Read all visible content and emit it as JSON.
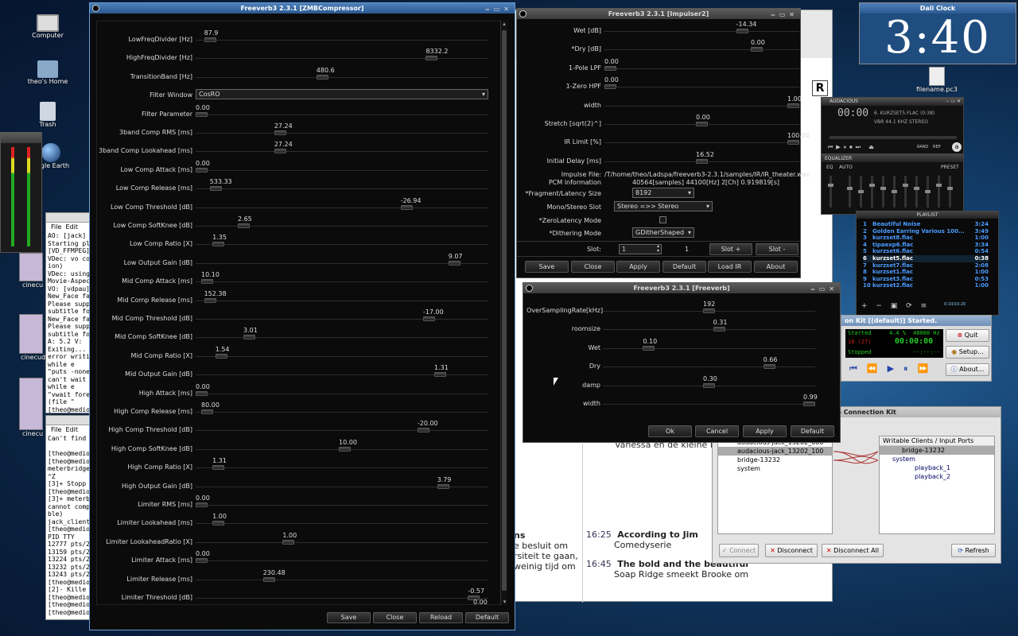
{
  "desktop": {
    "icons": [
      "Computer",
      "theo's Home",
      "Trash",
      "gle Earth",
      "cinecu",
      "cinecuda",
      "cinecu",
      "filename.pc3"
    ]
  },
  "clock": {
    "title": "Dali Clock",
    "time": "3:40"
  },
  "zmb": {
    "title": "Freeverb3 2.3.1 [ZMBCompressor]",
    "params": [
      {
        "label": "LowFreqDivider [Hz]",
        "value": "87.9",
        "pos": 0.03
      },
      {
        "label": "HighFreqDivider [Hz]",
        "value": "8332.2",
        "pos": 0.82
      },
      {
        "label": "TransitionBand [Hz]",
        "value": "480.6",
        "pos": 0.43
      },
      {
        "label": "Filter Window",
        "select": "CosRO"
      },
      {
        "label": "Filter Parameter",
        "value": "0.00",
        "pos": 0.0
      },
      {
        "label": "3band Comp RMS [ms]",
        "value": "27.24",
        "pos": 0.28
      },
      {
        "label": "3band Comp Lookahead [ms]",
        "value": "27.24",
        "pos": 0.28
      },
      {
        "label": "Low Comp Attack [ms]",
        "value": "0.00",
        "pos": 0.0
      },
      {
        "label": "Low Comp Release [ms]",
        "value": "533.33",
        "pos": 0.05
      },
      {
        "label": "Low Comp Threshold [dB]",
        "value": "-26.94",
        "pos": 0.73
      },
      {
        "label": "Low Comp SoftKnee [dB]",
        "value": "2.65",
        "pos": 0.15
      },
      {
        "label": "Low Comp Ratio [X]",
        "value": "1.35",
        "pos": 0.06
      },
      {
        "label": "Low Output Gain [dB]",
        "value": "9.07",
        "pos": 0.9
      },
      {
        "label": "Mid Comp Attack [ms]",
        "value": "10.10",
        "pos": 0.02
      },
      {
        "label": "Mid Comp Release [ms]",
        "value": "152.38",
        "pos": 0.03
      },
      {
        "label": "Mid Comp Threshold [dB]",
        "value": "-17.00",
        "pos": 0.81
      },
      {
        "label": "Mid Comp SoftKnee [dB]",
        "value": "3.01",
        "pos": 0.17
      },
      {
        "label": "Mid Comp Ratio [X]",
        "value": "1.54",
        "pos": 0.07
      },
      {
        "label": "Mid Output Gain [dB]",
        "value": "1.31",
        "pos": 0.85
      },
      {
        "label": "High Attack [ms]",
        "value": "0.00",
        "pos": 0.0
      },
      {
        "label": "High Comp Release [ms]",
        "value": "80.00",
        "pos": 0.02
      },
      {
        "label": "High Comp Threshold [dB]",
        "value": "-20.00",
        "pos": 0.79
      },
      {
        "label": "High Comp SoftKnee [dB]",
        "value": "10.00",
        "pos": 0.51
      },
      {
        "label": "High Comp Ratio [X]",
        "value": "1.31",
        "pos": 0.06
      },
      {
        "label": "High Output Gain [dB]",
        "value": "3.79",
        "pos": 0.86
      },
      {
        "label": "Limiter RMS [ms]",
        "value": "0.00",
        "pos": 0.0
      },
      {
        "label": "Limiter Lookahead [ms]",
        "value": "1.00",
        "pos": 0.06
      },
      {
        "label": "Limiter LookaheadRatio [X]",
        "value": "1.00",
        "pos": 0.31
      },
      {
        "label": "Limiter Attack [ms]",
        "value": "0.00",
        "pos": 0.0
      },
      {
        "label": "Limiter Release [ms]",
        "value": "230.48",
        "pos": 0.24
      },
      {
        "label": "Limiter Threshold [dB]",
        "value": "-0.57",
        "pos": 0.97
      }
    ],
    "trailing_value": "0.00",
    "buttons": [
      "Save",
      "Close",
      "Reload",
      "Default"
    ]
  },
  "impulser": {
    "title": "Freeverb3 2.3.1 [Impulser2]",
    "params": [
      {
        "label": "Wet [dB]",
        "value": "-14.34",
        "pos": 0.72
      },
      {
        "label": "*Dry [dB]",
        "value": "0.00",
        "pos": 0.8
      },
      {
        "label": "1-Pole LPF",
        "value": "0.00",
        "pos": 0.0
      },
      {
        "label": "1-Zero HPF",
        "value": "0.00",
        "pos": 0.0
      },
      {
        "label": "width",
        "value": "1.00",
        "pos": 1.0
      },
      {
        "label": "Stretch [sqrt(2)^]",
        "value": "0.00",
        "pos": 0.5
      },
      {
        "label": "IR Limit [%]",
        "value": "100.00",
        "pos": 1.0
      },
      {
        "label": "Initial Delay [ms]",
        "value": "16.52",
        "pos": 0.5
      }
    ],
    "impulse_label": "Impulse File:",
    "impulse_file": "/T/home/theo/Ladspa/freeverb3-2.3.1/samples/IR/IR_theater.wav",
    "pcm_label": "PCM information",
    "pcm_info": "40564[samples] 44100[Hz] 2[Ch] 0.919819[s]",
    "frag_label": "*Fragment/Latency Size",
    "frag_value": "8192",
    "mono_label": "Mono/Stereo Slot",
    "mono_value": "Stereo =>> Stereo",
    "zero_label": "*ZeroLatency Mode",
    "dither_label": "*Dithering Mode",
    "dither_value": "GDitherShaped",
    "slot_label": "Slot:",
    "slot_value": "1",
    "slot_count": "1",
    "slot_plus": "Slot +",
    "slot_minus": "Slot -",
    "buttons": [
      "Save",
      "Close",
      "Apply",
      "Default",
      "Load IR",
      "About"
    ]
  },
  "freeverb": {
    "title": "Freeverb3 2.3.1 [Freeverb]",
    "params": [
      {
        "label": "OverSamplingRate[kHz]",
        "value": "192",
        "pos": 0.5
      },
      {
        "label": "roomsize",
        "value": "0.31",
        "pos": 0.55
      },
      {
        "label": "Wet",
        "value": "0.10",
        "pos": 0.2
      },
      {
        "label": "Dry",
        "value": "0.66",
        "pos": 0.8
      },
      {
        "label": "damp",
        "value": "0.30",
        "pos": 0.5
      },
      {
        "label": "width",
        "value": "0.99",
        "pos": 1.0
      }
    ],
    "buttons": [
      "Ok",
      "Cancel",
      "Apply",
      "Default"
    ]
  },
  "audacious": {
    "title": "AUDACIOUS",
    "time": "00:00",
    "track": "6. KURZSET5.FLAC (0:38)",
    "info": "VBR 44.1 KHZ STEREO",
    "rand": "RAND",
    "rep": "REP",
    "eq_title": "EQUALIZER",
    "eq_on": "EQ",
    "eq_auto": "AUTO",
    "eq_preset": "PRESET",
    "pl_title": "PLAYLIST",
    "playlist": [
      {
        "n": "1",
        "t": "Beautiful Noise",
        "d": "3:24"
      },
      {
        "n": "2",
        "t": "Golden Earring Various 100...",
        "d": "3:49"
      },
      {
        "n": "3",
        "t": "kurzset8.flac",
        "d": "1:00"
      },
      {
        "n": "4",
        "t": "tipaexp6.flac",
        "d": "3:34"
      },
      {
        "n": "5",
        "t": "kurzset6.flac",
        "d": "0:54"
      },
      {
        "n": "6",
        "t": "kurzset5.flac",
        "d": "0:38"
      },
      {
        "n": "7",
        "t": "kurzset7.flac",
        "d": "2:08"
      },
      {
        "n": "8",
        "t": "kurzset1.flac",
        "d": "1:00"
      },
      {
        "n": "9",
        "t": "kurzset3.flac",
        "d": "0:53"
      },
      {
        "n": "10",
        "t": "kurzset2.flac",
        "d": "1:00"
      }
    ],
    "pl_time": "0:10/10:20"
  },
  "jack": {
    "title": "on Kit [(default)] Started.",
    "started": "Started",
    "pct": "4.4 %",
    "rate": "48000 Hz",
    "xruns": "18 (27)",
    "time": "00:00:00",
    "stopped": "Stopped",
    "dashes": "--:--:--",
    "quit": "Quit",
    "setup": "Setup...",
    "about": "About..."
  },
  "conn": {
    "title": "Audio Connection Kit",
    "right_header": "Writable Clients / Input Ports",
    "left": [
      "audacious-jack_13202_000",
      "audacious-jack_13202_100",
      "bridge-13232",
      "system"
    ],
    "right": [
      "bridge-13232",
      "system",
      "playback_1",
      "playback_2"
    ],
    "buttons": [
      "Connect",
      "Disconnect",
      "Disconnect All",
      "Refresh"
    ]
  },
  "tv": {
    "rows": [
      {
        "time": "16:25",
        "title": "According to Jim",
        "sub": "Comedyserie"
      },
      {
        "time": "16:45",
        "title": "The bold and the beautiful",
        "sub": "Soap Ridge smeekt Brooke om"
      }
    ],
    "left_lines": [
      "ns",
      "e besluit om",
      "rsiteit te gaan,",
      "weinig tijd om"
    ],
    "top_text": "Vanessa en de kleine F"
  },
  "term1": {
    "menu": [
      "File",
      "Edit"
    ],
    "lines": [
      "AO: [jack]",
      "Starting pl",
      "[VD_FFMPEG]",
      "VDec: vo co",
      "ion)",
      "VDec: using",
      "Movie-Aspec",
      "VO: [vdpau]",
      "New_Face fa",
      "Please supp",
      "subtitle fo",
      "New_Face fa",
      "Please supp",
      "subtitle fo",
      "A:   5.2 V:",
      "Exiting...",
      "error writi",
      "    while e",
      "\"puts -none",
      "can't wait",
      "    while e",
      "\"vwait fore",
      "    (file \"",
      "[theo@medio"
    ]
  },
  "term2": {
    "menu": [
      "File",
      "Edit"
    ],
    "lines": [
      "Can't find",
      "",
      "[theo@medio",
      "[theo@medio",
      "meterbridge",
      "^Z",
      "[3]+  Stopp",
      "[theo@medio",
      "[3]+ meterb",
      "cannot comp",
      "ble)",
      "jack_client",
      "[theo@medio",
      "  PID TTY",
      "12777 pts/2",
      "13159 pts/2",
      "13224 pts/2",
      "13232 pts/2",
      "13243 pts/2",
      "[theo@medio",
      "[2]-  Kille",
      "[theo@medio",
      "[theo@medio",
      "[theo@medio"
    ]
  }
}
